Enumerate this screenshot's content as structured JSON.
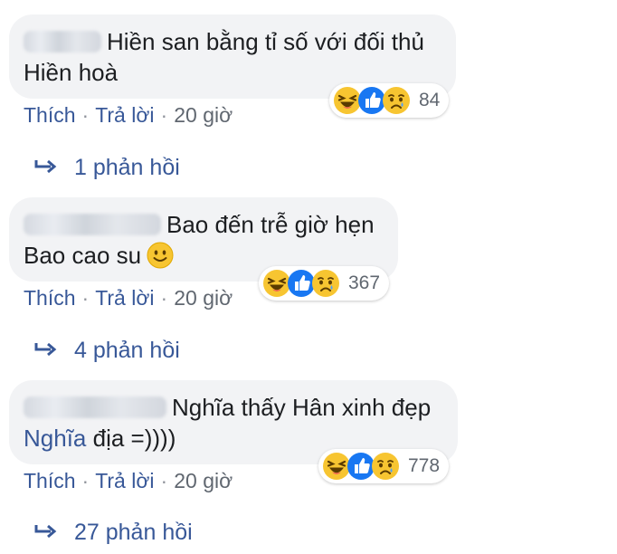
{
  "comments": [
    {
      "text": "Hiền san bằng tỉ số với đối thủ Hiền hoà",
      "line1": "Hiền san bằng tỉ số với đối thủ",
      "line2": "Hiền hoà",
      "reaction_count": "84",
      "like": "Thích",
      "reply": "Trả lời",
      "time": "20 giờ",
      "replies": "1 phản hồi"
    },
    {
      "text": "Bao đến trễ giờ hẹn Bao cao su 🙂",
      "line1": "Bao đến trễ giờ hẹn",
      "line2": "Bao cao su",
      "reaction_count": "367",
      "like": "Thích",
      "reply": "Trả lời",
      "time": "20 giờ",
      "replies": "4 phản hồi"
    },
    {
      "text": "Nghĩa thấy Hân xinh đẹp Nghĩa địa =))))",
      "line1": "Nghĩa thấy Hân xinh đẹp",
      "mention": "Nghĩa",
      "line2_rest": " địa =))))",
      "reaction_count": "778",
      "like": "Thích",
      "reply": "Trả lời",
      "time": "20 giờ",
      "replies": "27 phản hồi"
    }
  ],
  "reaction_icons": [
    "haha-icon",
    "like-icon",
    "sad-icon"
  ],
  "colors": {
    "bubble": "#f2f3f5",
    "link": "#385898",
    "meta": "#606770",
    "reaction_yellow": "#f7c531",
    "like_blue": "#1877f2"
  }
}
